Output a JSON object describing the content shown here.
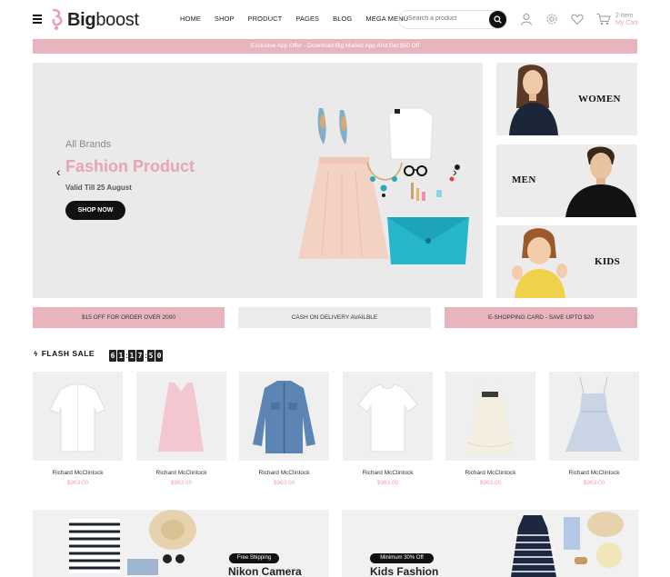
{
  "brand": {
    "name_bold": "Big",
    "name_rest": "boost"
  },
  "nav": [
    "HOME",
    "SHOP",
    "PRODUCT",
    "PAGES",
    "BLOG",
    "MEGA MENU"
  ],
  "search": {
    "placeholder": "Search a product"
  },
  "cart": {
    "count": "2 item",
    "label": "My Cart"
  },
  "offer_bar": "Exclusive App Offer - Download Big Market App And Get $50 Off",
  "hero": {
    "brand": "All Brands",
    "title": "Fashion Product",
    "valid": "Valid Till 25 August",
    "button": "SHOP NOW",
    "prev": "‹",
    "next": "›"
  },
  "categories": [
    {
      "label": "WOMEN"
    },
    {
      "label": "MEN"
    },
    {
      "label": "KIDS"
    }
  ],
  "promos": [
    {
      "text": "$15 OFF FOR ORDER OVER 2000",
      "bg": "#e8b4be"
    },
    {
      "text": "CASH ON DELIVERY AVAILBLE",
      "bg": "#ececec"
    },
    {
      "text": "E-SHOPPING CARD - SAVE UPTO $20",
      "bg": "#e8b4be"
    }
  ],
  "flash_sale": {
    "title": "FLASH SALE",
    "countdown": [
      "6",
      "1",
      "1",
      "7",
      "5",
      "0"
    ]
  },
  "products": [
    {
      "name": "Richard McClintock",
      "price": "$963.00",
      "item": "white-shirt"
    },
    {
      "name": "Richard McClintock",
      "price": "$963.00",
      "item": "pink-top"
    },
    {
      "name": "Richard McClintock",
      "price": "$963.00",
      "item": "denim-jacket"
    },
    {
      "name": "Richard McClintock",
      "price": "$963.00",
      "item": "white-tee"
    },
    {
      "name": "Richard McClintock",
      "price": "$963.00",
      "item": "cream-top"
    },
    {
      "name": "Richard McClintock",
      "price": "$963.00",
      "item": "blue-dress"
    }
  ],
  "banners": [
    {
      "tag": "Free Shipping",
      "title": "Nikon Camera"
    },
    {
      "tag": "Minimum 30% Off",
      "title": "Kids Fashion"
    }
  ],
  "colors": {
    "accent_pink": "#e7a4b1",
    "bar_pink": "#e8b4be",
    "dark": "#111111"
  }
}
